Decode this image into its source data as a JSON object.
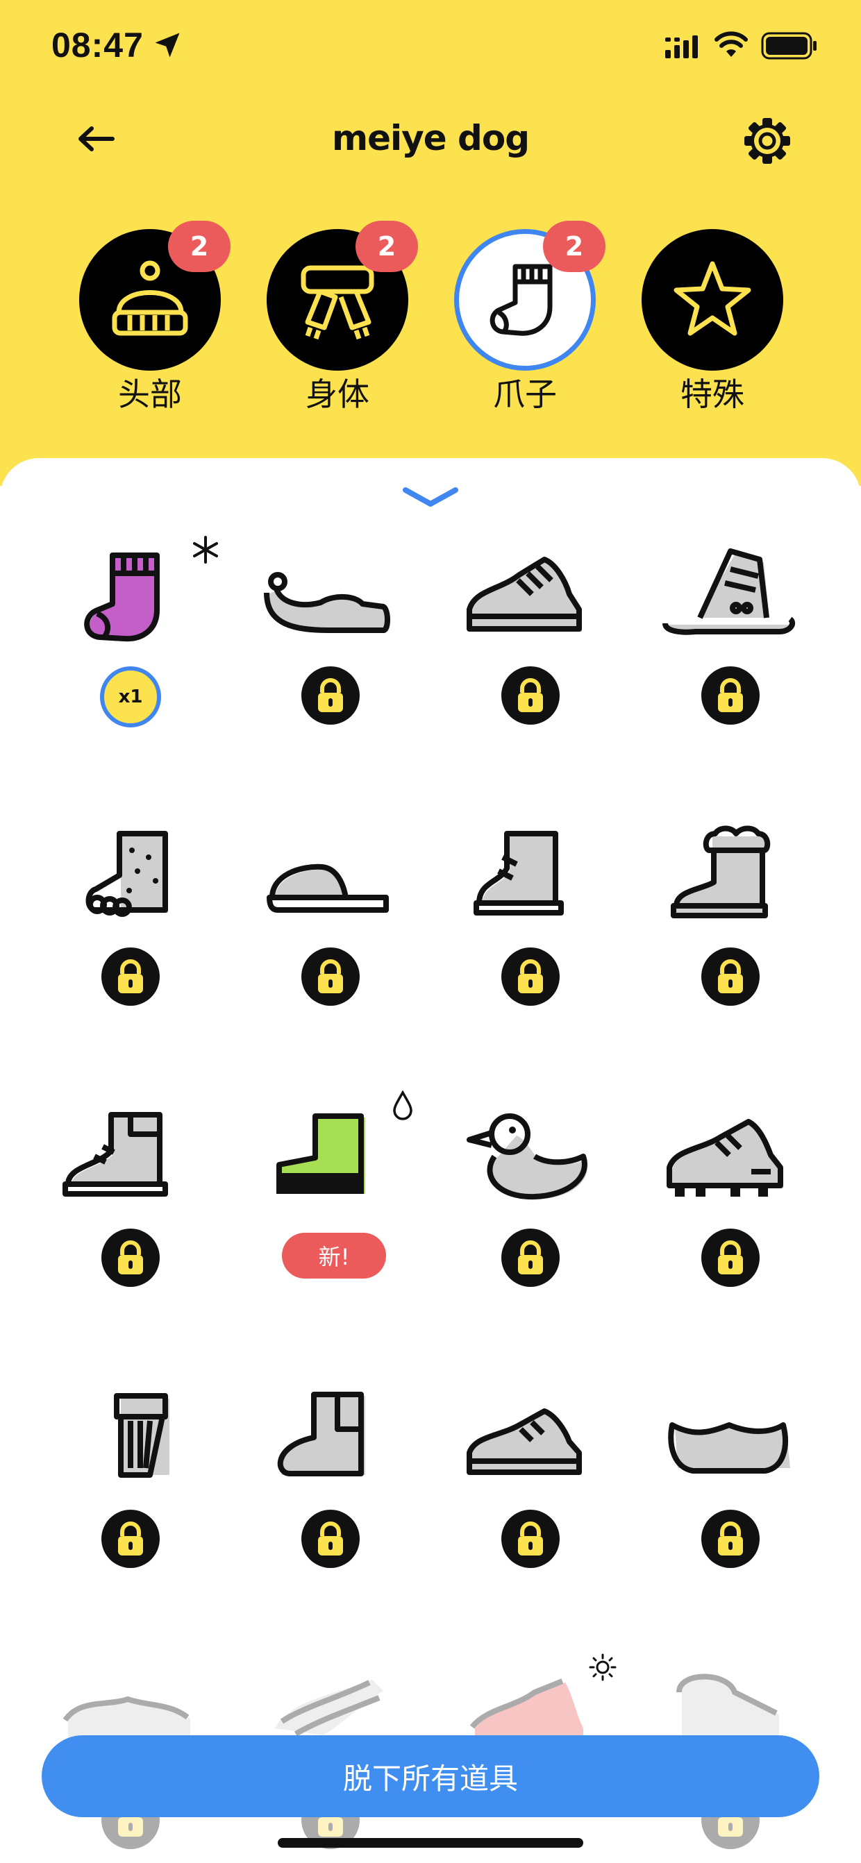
{
  "status_bar": {
    "time": "08:47",
    "icons": [
      "location-arrow-icon",
      "cellular-signal-icon",
      "wifi-icon",
      "battery-icon"
    ]
  },
  "header": {
    "title": "meiye dog",
    "back_icon": "arrow-left-icon",
    "settings_icon": "gear-icon"
  },
  "colors": {
    "header_bg": "#FCE24F",
    "accent_blue": "#3F86F0",
    "badge_red": "#EC5B5B",
    "lock_bg": "#111111",
    "lock_fg": "#FCE24F"
  },
  "categories": [
    {
      "label": "头部",
      "badge": "2",
      "icon": "beanie-hat-icon",
      "selected": false
    },
    {
      "label": "身体",
      "badge": "2",
      "icon": "scarf-icon",
      "selected": false
    },
    {
      "label": "爪子",
      "badge": "2",
      "icon": "sock-icon",
      "selected": true
    },
    {
      "label": "特殊",
      "badge": "",
      "icon": "star-icon",
      "selected": false
    }
  ],
  "items": [
    {
      "icon": "pink-sock-icon",
      "state": "owned",
      "count_label": "x1",
      "mark": "snowflake-icon"
    },
    {
      "icon": "elf-shoe-icon",
      "state": "locked"
    },
    {
      "icon": "sneaker-icon",
      "state": "locked"
    },
    {
      "icon": "ski-boot-icon",
      "state": "locked"
    },
    {
      "icon": "fuzzy-bootie-icon",
      "state": "locked"
    },
    {
      "icon": "slipper-icon",
      "state": "locked"
    },
    {
      "icon": "ankle-boot-icon",
      "state": "locked"
    },
    {
      "icon": "fur-boot-icon",
      "state": "locked"
    },
    {
      "icon": "hiking-boot-icon",
      "state": "locked"
    },
    {
      "icon": "green-rain-boot-icon",
      "state": "new",
      "new_label": "新!",
      "mark": "water-drop-icon"
    },
    {
      "icon": "duck-slipper-icon",
      "state": "locked"
    },
    {
      "icon": "soccer-cleat-icon",
      "state": "locked"
    },
    {
      "icon": "fringe-moccasin-icon",
      "state": "locked"
    },
    {
      "icon": "chelsea-boot-icon",
      "state": "locked"
    },
    {
      "icon": "low-sneaker-icon",
      "state": "locked"
    },
    {
      "icon": "clog-icon",
      "state": "locked"
    },
    {
      "icon": "loafer-icon",
      "state": "locked"
    },
    {
      "icon": "sandal-icon",
      "state": "locked"
    },
    {
      "icon": "red-sneaker-icon",
      "state": "new",
      "mark": "sun-icon"
    },
    {
      "icon": "rain-boot-icon",
      "state": "locked"
    }
  ],
  "actions": {
    "remove_all_label": "脱下所有道具"
  }
}
